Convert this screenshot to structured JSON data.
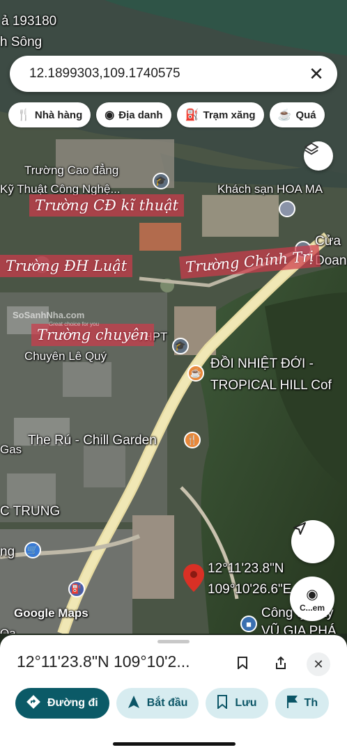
{
  "search": {
    "value": "12.1899303,109.1740575",
    "clear_icon": "close-icon"
  },
  "chips": [
    {
      "label": "Nhà hàng",
      "icon": "fork-knife-icon"
    },
    {
      "label": "Địa danh",
      "icon": "landmark-icon"
    },
    {
      "label": "Trạm xăng",
      "icon": "gas-pump-icon"
    },
    {
      "label": "Quá",
      "icon": "cup-icon"
    }
  ],
  "map": {
    "top_left_labels": {
      "line1": "ả 193180",
      "line2": "h Sông"
    },
    "places": {
      "cao_dang_1": "Trường Cao đẳng",
      "cao_dang_2": "Kỹ Thuật Công Nghệ...",
      "hotel": "Khách sạn HOA MA",
      "cua_1": "Cửa",
      "cua_2": "Doan",
      "thpt_1": "THPT",
      "thpt_2": "Chuyên Lê Quý",
      "tropical_1": "ĐỒI NHIỆT ĐỚI -",
      "tropical_2": "TROPICAL HILL Cof",
      "gas": "Gas",
      "chill": "The Rú - Chill Garden",
      "c_trung": "C TRUNG",
      "ng": "ng",
      "cong_ty_1": "Công ty Xây",
      "cong_ty_2": "VŨ GIA PHÁ",
      "oa": "Oa"
    },
    "handwritten": {
      "cd_ki_thuat": "Trường CĐ kĩ thuật",
      "dh_luat": "Trường ĐH Luật",
      "chinh_tri": "Trường Chính Trị",
      "chuyen": "Trường chuyên"
    },
    "watermark": {
      "brand": "SoSanhNha.com",
      "tagline": "Great choice for you"
    },
    "pin_coords": {
      "lat": "12°11'23.8\"N",
      "lng": "109°10'26.6\"E"
    },
    "google_maps": "Google Maps",
    "lens_button_label": "C...em"
  },
  "sheet": {
    "coords": "12°11'23.8\"N 109°10'2...",
    "actions": [
      {
        "label": "Đường đi",
        "icon": "directions-icon"
      },
      {
        "label": "Bắt đầu",
        "icon": "navigation-arrow-icon"
      },
      {
        "label": "Lưu",
        "icon": "bookmark-icon"
      },
      {
        "label": "Th",
        "icon": "flag-icon"
      }
    ]
  },
  "colors": {
    "accent": "#0b5a67",
    "chip_bg": "#d7ecf0",
    "pin": "#d93025",
    "handwritten_bg": "#cd3c4b"
  }
}
